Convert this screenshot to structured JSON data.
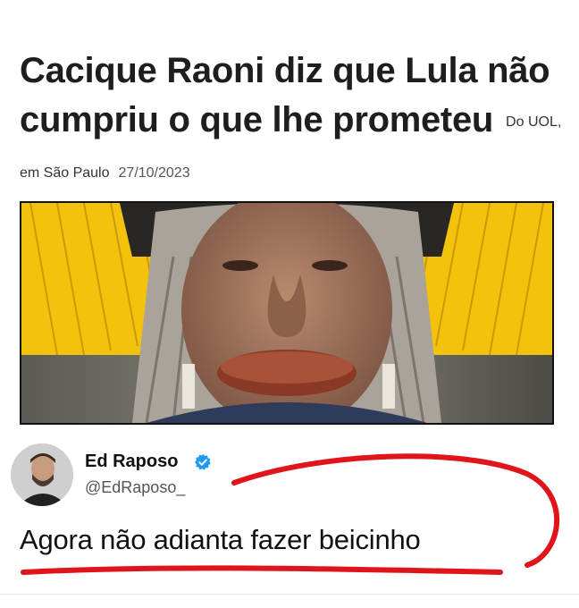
{
  "article": {
    "headline": "Cacique Raoni diz que Lula não cumpriu o que lhe prometeu",
    "source": "Do UOL, em São Paulo",
    "date": "27/10/2023"
  },
  "photo": {
    "icon": "portrait-photo"
  },
  "tweet": {
    "display_name": "Ed Raposo",
    "handle": "@EdRaposo_",
    "verified": true,
    "text": "Agora não adianta fazer beicinho"
  },
  "colors": {
    "headline": "#1e1e1e",
    "verified_badge": "#1d9bf0",
    "red_markup": "#e0151c",
    "feathers": "#f2c20c"
  }
}
